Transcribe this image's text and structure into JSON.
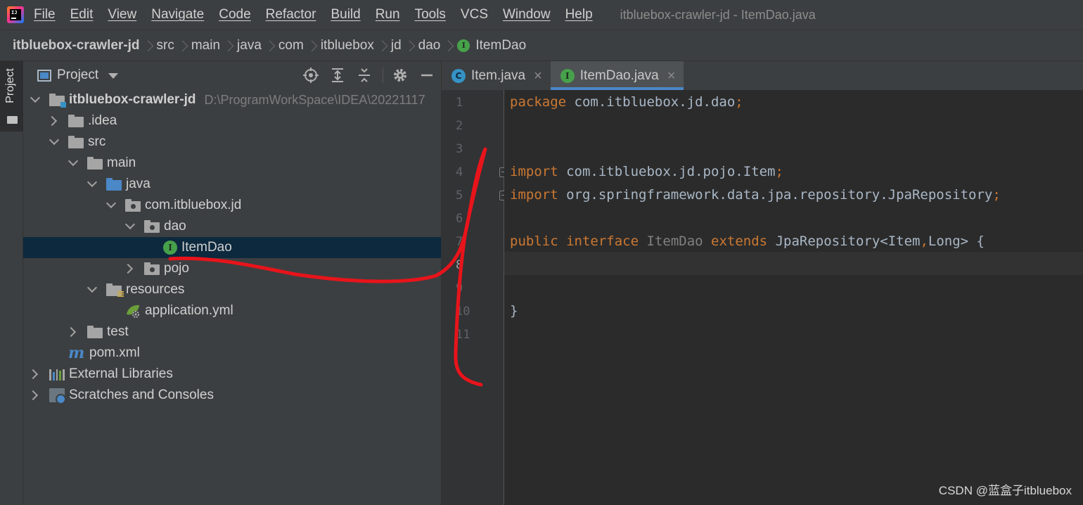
{
  "menubar": {
    "items": [
      "File",
      "Edit",
      "View",
      "Navigate",
      "Code",
      "Refactor",
      "Build",
      "Run",
      "Tools",
      "VCS",
      "Window",
      "Help"
    ],
    "window_title": "itbluebox-crawler-jd - ItemDao.java"
  },
  "breadcrumb": [
    "itbluebox-crawler-jd",
    "src",
    "main",
    "java",
    "com",
    "itbluebox",
    "jd",
    "dao",
    "ItemDao"
  ],
  "left_stripe": {
    "label": "Project"
  },
  "project": {
    "title": "Project",
    "tree": [
      {
        "label": "itbluebox-crawler-jd",
        "hint": "D:\\ProgramWorkSpace\\IDEA\\20221117"
      },
      {
        "label": ".idea"
      },
      {
        "label": "src"
      },
      {
        "label": "main"
      },
      {
        "label": "java"
      },
      {
        "label": "com.itbluebox.jd"
      },
      {
        "label": "dao"
      },
      {
        "label": "ItemDao"
      },
      {
        "label": "pojo"
      },
      {
        "label": "resources"
      },
      {
        "label": "application.yml"
      },
      {
        "label": "test"
      },
      {
        "label": "pom.xml"
      },
      {
        "label": "External Libraries"
      },
      {
        "label": "Scratches and Consoles"
      }
    ]
  },
  "editor": {
    "tabs": [
      {
        "label": "Item.java",
        "icon": "class-icon"
      },
      {
        "label": "ItemDao.java",
        "icon": "interface-icon",
        "active": true
      }
    ],
    "line_numbers": [
      "1",
      "2",
      "3",
      "4",
      "5",
      "6",
      "7",
      "8",
      "9",
      "10",
      "11"
    ],
    "code": {
      "l1_kw": "package",
      "l1_rest": " com.itbluebox.jd.dao",
      "l1_end": ";",
      "l4_kw": "import",
      "l4_rest": " com.itbluebox.jd.pojo.Item",
      "l4_end": ";",
      "l5_kw": "import",
      "l5_rest": " org.springframework.data.jpa.repository.JpaRepository",
      "l5_end": ";",
      "l7_kw1": "public",
      "l7_kw2": "interface",
      "l7_name": "ItemDao",
      "l7_kw3": "extends",
      "l7_type": "JpaRepository<Item",
      "l7_comma": ",",
      "l7_rest": "Long> {",
      "l10": "}"
    },
    "cursor_line": "8"
  },
  "icons": {
    "interface_letter": "I",
    "class_letter": "C",
    "maven_letter": "m"
  },
  "colors": {
    "keyword": "#cc7832",
    "text": "#a9b7c6",
    "selection": "#0d293e",
    "accent": "#4a88c7",
    "annotation": "#e8141b"
  },
  "watermark": "CSDN @蓝盒子itbluebox"
}
